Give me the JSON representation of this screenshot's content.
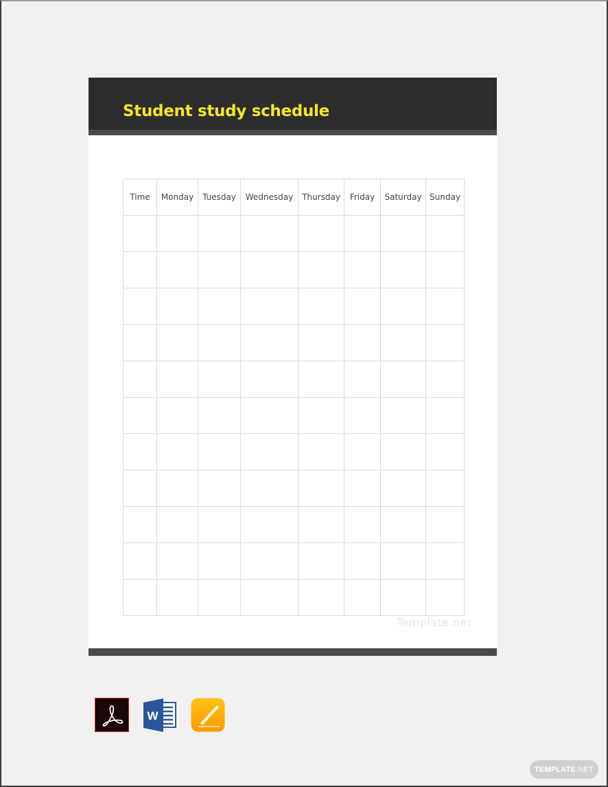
{
  "document": {
    "title": "Student study schedule",
    "watermark": "Template.net",
    "colors": {
      "header_background": "#2e2d2b",
      "header_stripe": "#4b4a50",
      "title_color": "#f4e535",
      "footer_band": "#4a494e",
      "page_background": "#f2f1ef"
    }
  },
  "schedule": {
    "columns": [
      "Time",
      "Monday",
      "Tuesday",
      "Wednesday",
      "Thursday",
      "Friday",
      "Saturday",
      "Sunday"
    ],
    "rows": [
      [
        "",
        "",
        "",
        "",
        "",
        "",
        "",
        ""
      ],
      [
        "",
        "",
        "",
        "",
        "",
        "",
        "",
        ""
      ],
      [
        "",
        "",
        "",
        "",
        "",
        "",
        "",
        ""
      ],
      [
        "",
        "",
        "",
        "",
        "",
        "",
        "",
        ""
      ],
      [
        "",
        "",
        "",
        "",
        "",
        "",
        "",
        ""
      ],
      [
        "",
        "",
        "",
        "",
        "",
        "",
        "",
        ""
      ],
      [
        "",
        "",
        "",
        "",
        "",
        "",
        "",
        ""
      ],
      [
        "",
        "",
        "",
        "",
        "",
        "",
        "",
        ""
      ],
      [
        "",
        "",
        "",
        "",
        "",
        "",
        "",
        ""
      ],
      [
        "",
        "",
        "",
        "",
        "",
        "",
        "",
        ""
      ],
      [
        "",
        "",
        "",
        "",
        "",
        "",
        "",
        ""
      ]
    ]
  },
  "formats": [
    {
      "name": "adobe-pdf",
      "icon": "adobe-acrobat-icon",
      "glyph": "A"
    },
    {
      "name": "ms-word",
      "icon": "microsoft-word-icon",
      "glyph": "W"
    },
    {
      "name": "apple-pages",
      "icon": "apple-pages-icon",
      "glyph": ""
    }
  ],
  "branding": {
    "badge_bold": "TEMPLATE",
    "badge_light": ".NET"
  }
}
